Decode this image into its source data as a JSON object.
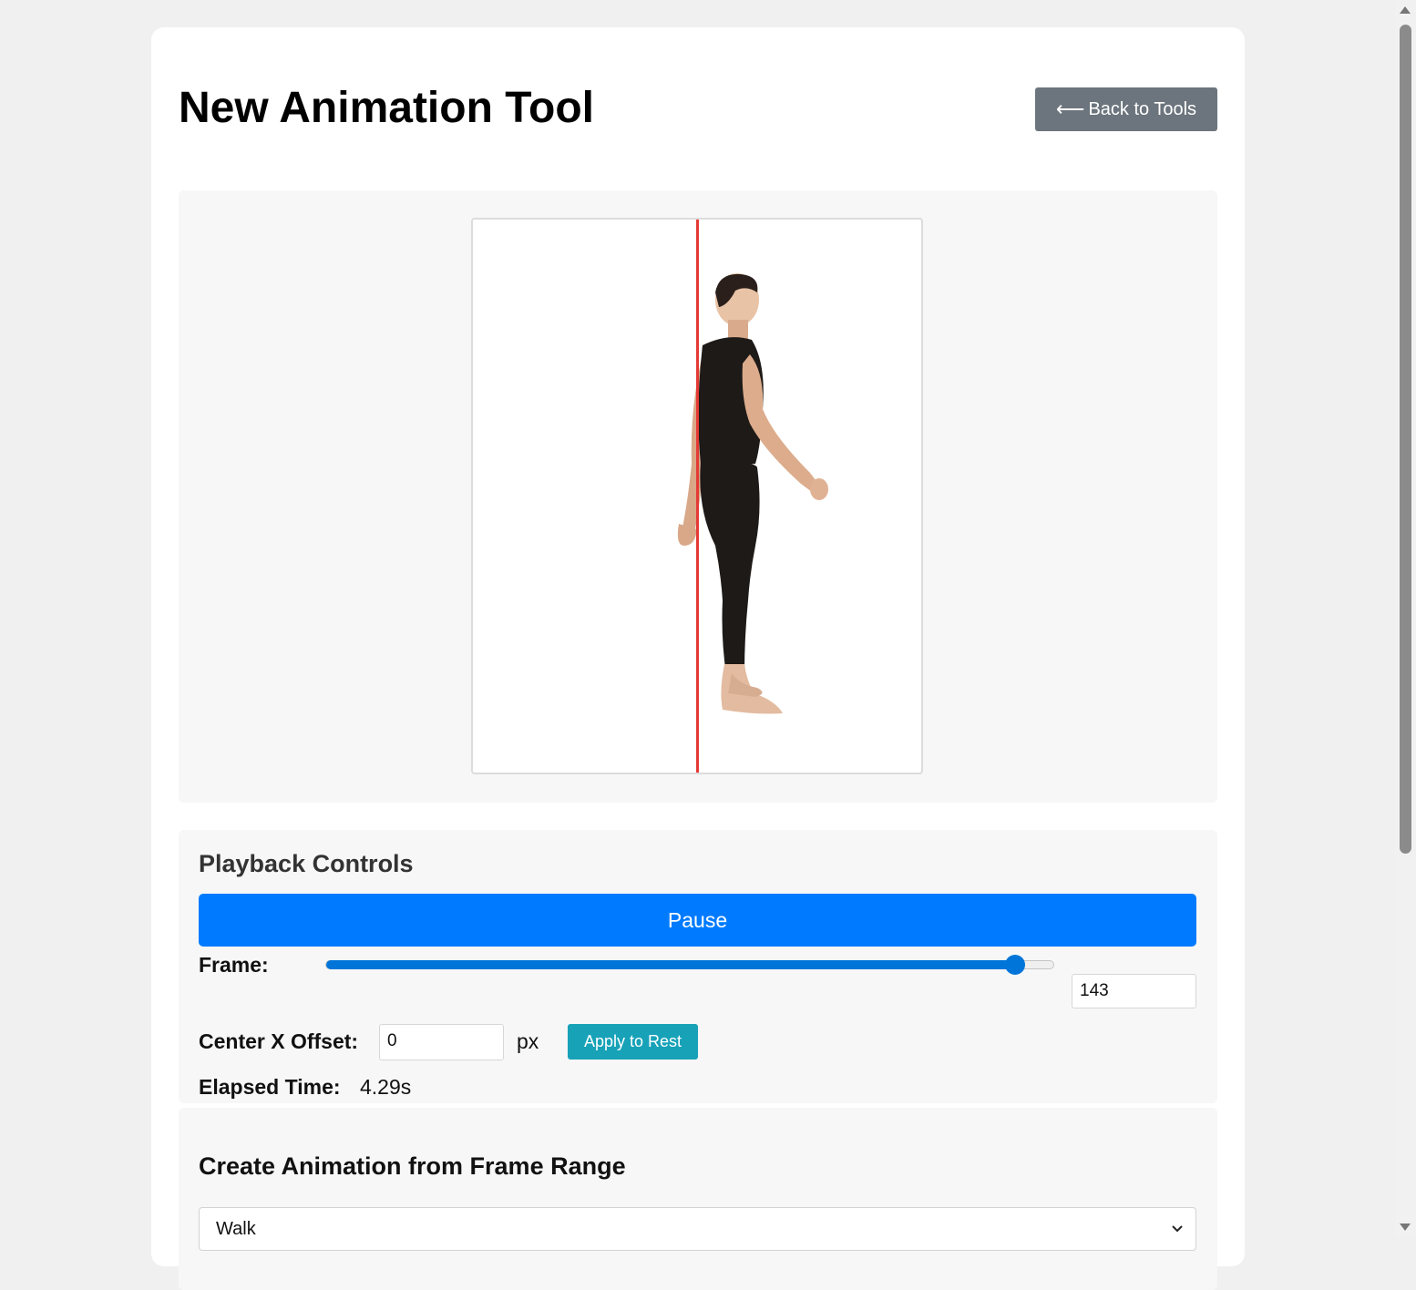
{
  "header": {
    "title": "New Animation Tool",
    "back_label": "Back to Tools",
    "back_icon": "left-arrow-icon"
  },
  "preview": {
    "center_line_color": "#e53935",
    "figure": "person-walking-side-view"
  },
  "playback": {
    "heading": "Playback Controls",
    "pause_label": "Pause",
    "frame_label": "Frame:",
    "frame_value": "143",
    "frame_slider_fraction": 0.947,
    "offset_label": "Center X Offset:",
    "offset_value": "0",
    "offset_unit": "px",
    "apply_label": "Apply to Rest",
    "elapsed_label": "Elapsed Time:",
    "elapsed_value": "4.29s"
  },
  "create": {
    "heading": "Create Animation from Frame Range",
    "selected_animation": "Walk"
  },
  "colors": {
    "primary": "#007bff",
    "secondary": "#6c757d",
    "info": "#17a2b8"
  }
}
